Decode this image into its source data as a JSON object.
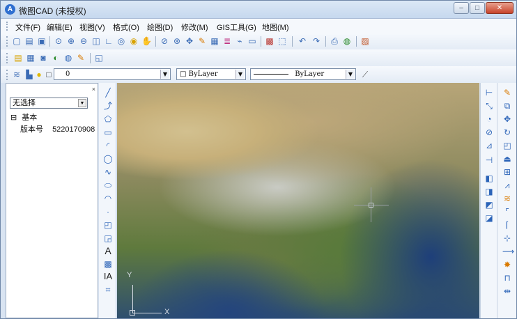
{
  "window": {
    "app_icon": "A",
    "title": "微图CAD (未授权)",
    "buttons": {
      "minimize": "–",
      "maximize": "□",
      "close": "✕"
    }
  },
  "menubar": {
    "items": [
      "文件(F)",
      "编辑(E)",
      "视图(V)",
      "格式(O)",
      "绘图(D)",
      "修改(M)",
      "GIS工具(G)",
      "地图(M)"
    ]
  },
  "toolbar3": {
    "layer_value": "0",
    "color_value": "ByLayer",
    "linetype_value": "ByLayer"
  },
  "left_panel": {
    "close": "×",
    "selection": "无选择",
    "group_toggle": "⊟",
    "group_label": "基本",
    "prop_name": "版本号",
    "prop_value": "5220170908"
  },
  "canvas": {
    "ucs_y": "Y",
    "ucs_x": "X"
  },
  "drawbar_text_tool": "A",
  "drawbar_mtext_tool": "IA",
  "icons": {
    "toolbar1": [
      "new-file-icon",
      "open-icon",
      "save-icon",
      "zoom-window-icon",
      "zoom-in-icon",
      "zoom-out-icon",
      "ruler-icon",
      "angle-icon",
      "zoom-extents-icon",
      "light-icon",
      "hand-icon",
      "zoom-prev-icon",
      "zoom-realtime-icon",
      "pan-icon",
      "pencil-icon",
      "image-icon",
      "layers-icon",
      "brush-icon",
      "rectangle-icon",
      "properties-icon",
      "selection-icon",
      "undo-icon",
      "redo-icon",
      "print-icon",
      "globe-icon",
      "photo-icon"
    ],
    "toolbar2": [
      "note-icon",
      "table-icon",
      "camera-icon",
      "cloud-icon",
      "globe-icon",
      "edit-icon",
      "window-icon"
    ],
    "drawbar": [
      "line-icon",
      "polyline-icon",
      "polygon-icon",
      "rectangle-icon",
      "arc-icon",
      "circle-icon",
      "spline-icon",
      "ellipse-icon",
      "ellipse-arc-icon",
      "point-icon",
      "insert-block-icon",
      "make-block-icon",
      "text-icon",
      "hatch-icon",
      "mtext-icon",
      "table-icon"
    ],
    "rightbar1": [
      "dimension-linear-icon",
      "dimension-aligned-icon",
      "dimension-radius-icon",
      "dimension-diameter-icon",
      "dimension-angle-icon",
      "dimension-continue-icon",
      "layer-icon-a",
      "layer-icon-b",
      "layer-icon-c",
      "layer-icon-d"
    ],
    "rightbar2": [
      "pencil-icon",
      "copy-icon",
      "move-icon",
      "rotate-icon",
      "scale-icon",
      "stretch-icon",
      "array-icon",
      "mirror-icon",
      "offset-icon",
      "fillet-icon",
      "chamfer-icon",
      "trim-icon",
      "extend-icon",
      "explode-icon",
      "break-icon",
      "join-icon"
    ]
  }
}
